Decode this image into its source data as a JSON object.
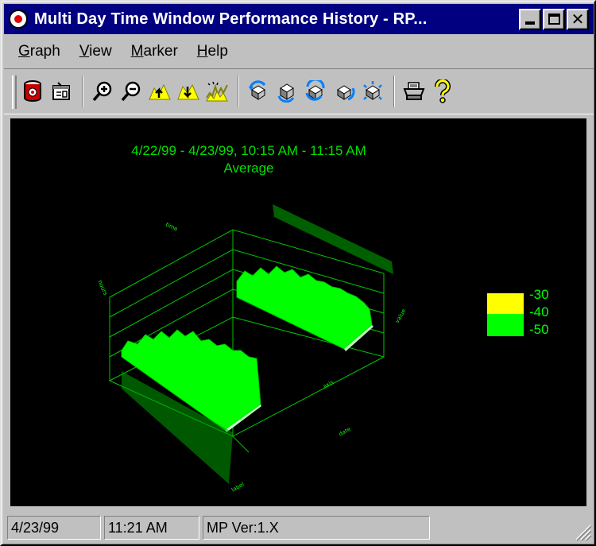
{
  "window": {
    "title": "Multi Day Time Window Performance History - RP...",
    "controls": {
      "minimize": "minimize",
      "maximize": "maximize",
      "close": "close"
    }
  },
  "menu": [
    "Graph",
    "View",
    "Marker",
    "Help"
  ],
  "toolbar": {
    "tools": [
      {
        "name": "database-icon"
      },
      {
        "name": "properties-icon"
      },
      {
        "name": "zoom-in-icon"
      },
      {
        "name": "zoom-out-icon"
      },
      {
        "name": "chart-up-icon"
      },
      {
        "name": "chart-down-icon"
      },
      {
        "name": "chart-spike-icon"
      },
      {
        "name": "rotate-left-icon"
      },
      {
        "name": "rotate-cube-icon"
      },
      {
        "name": "rotate-right-icon"
      },
      {
        "name": "rotate-down-icon"
      },
      {
        "name": "spin-icon"
      },
      {
        "name": "print-icon"
      },
      {
        "name": "help-icon"
      }
    ]
  },
  "graph": {
    "title_line1": "4/22/99 - 4/23/99, 10:15 AM - 11:15 AM",
    "title_line2": "Average",
    "legend": [
      {
        "label": "-30",
        "color": "#ffff00"
      },
      {
        "label": "-40",
        "color": "#00ff00"
      },
      {
        "label": "-50",
        "color": "#00ff00"
      }
    ],
    "plot_color": "#00ff00"
  },
  "status": {
    "date": "4/23/99",
    "time": "11:21 AM",
    "version": "MP Ver:1.X"
  }
}
